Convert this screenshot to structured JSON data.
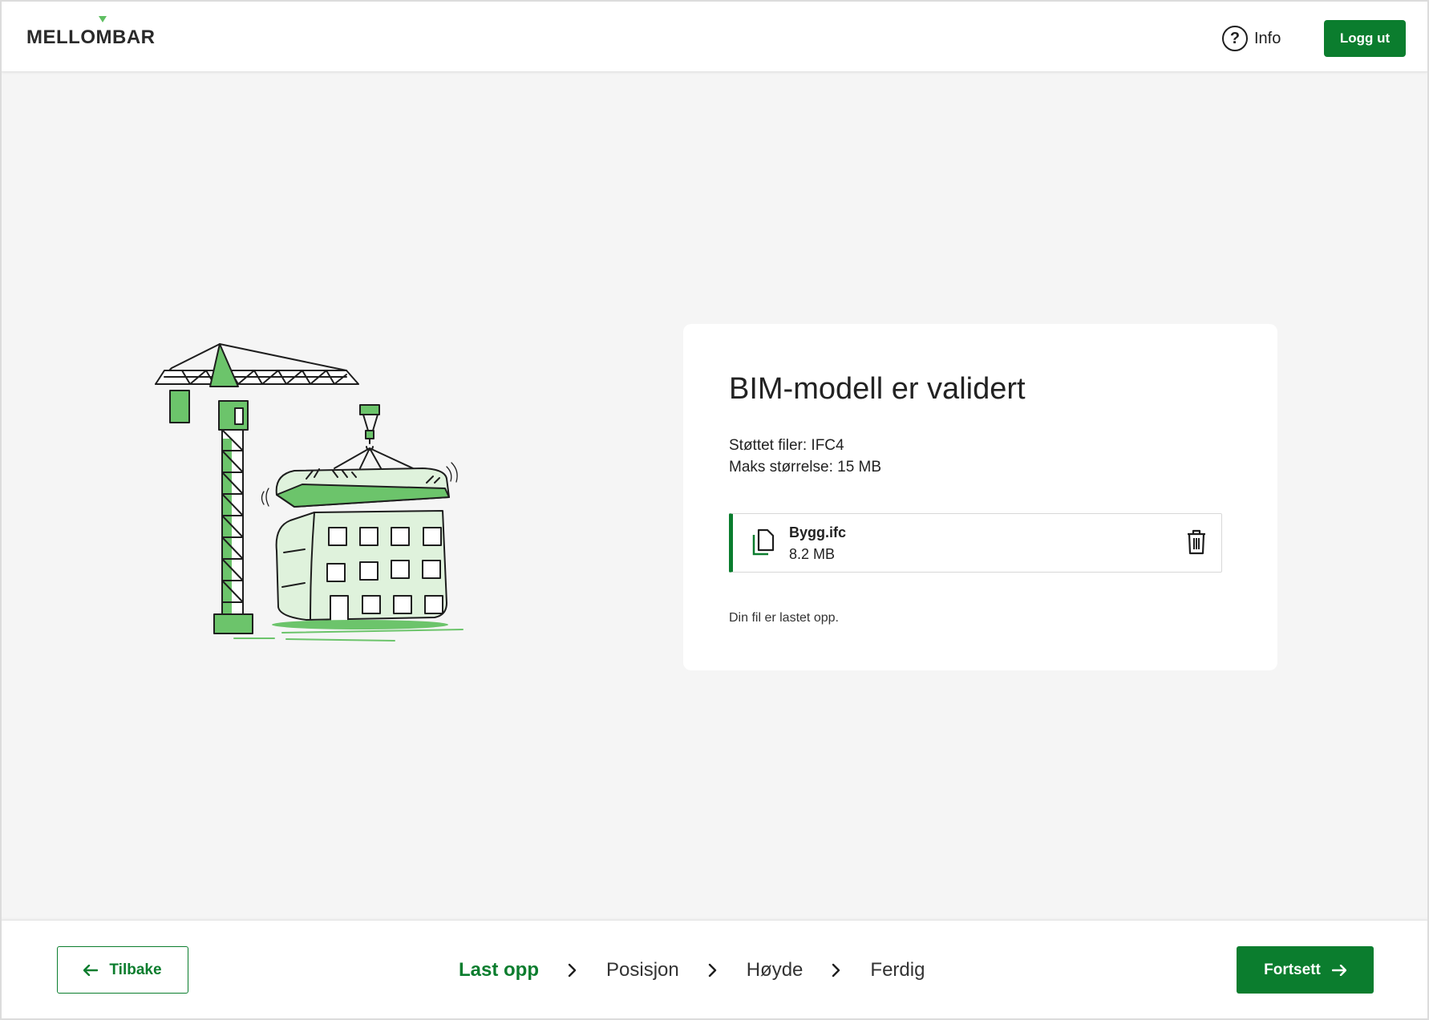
{
  "header": {
    "logo_text": "MELLOMBAR",
    "info_label": "Info",
    "logout_label": "Logg ut"
  },
  "card": {
    "title": "BIM-modell er validert",
    "supported_files": "Støttet filer: IFC4",
    "max_size": "Maks størrelse: 15 MB",
    "file": {
      "name": "Bygg.ifc",
      "size": "8.2 MB"
    },
    "status": "Din fil er lastet opp."
  },
  "footer": {
    "back_label": "Tilbake",
    "next_label": "Fortsett",
    "steps": [
      {
        "label": "Last opp",
        "active": true
      },
      {
        "label": "Posisjon",
        "active": false
      },
      {
        "label": "Høyde",
        "active": false
      },
      {
        "label": "Ferdig",
        "active": false
      }
    ]
  },
  "colors": {
    "primary": "#0b7d2e",
    "accent_light": "#dff2dc",
    "accent": "#6cc46b",
    "background": "#f5f5f5"
  },
  "icons": {
    "info": "question-circle-icon",
    "file": "file-copy-icon",
    "delete": "trash-icon",
    "back": "arrow-left-icon",
    "next": "arrow-right-icon",
    "step_separator": "chevron-right-icon"
  }
}
